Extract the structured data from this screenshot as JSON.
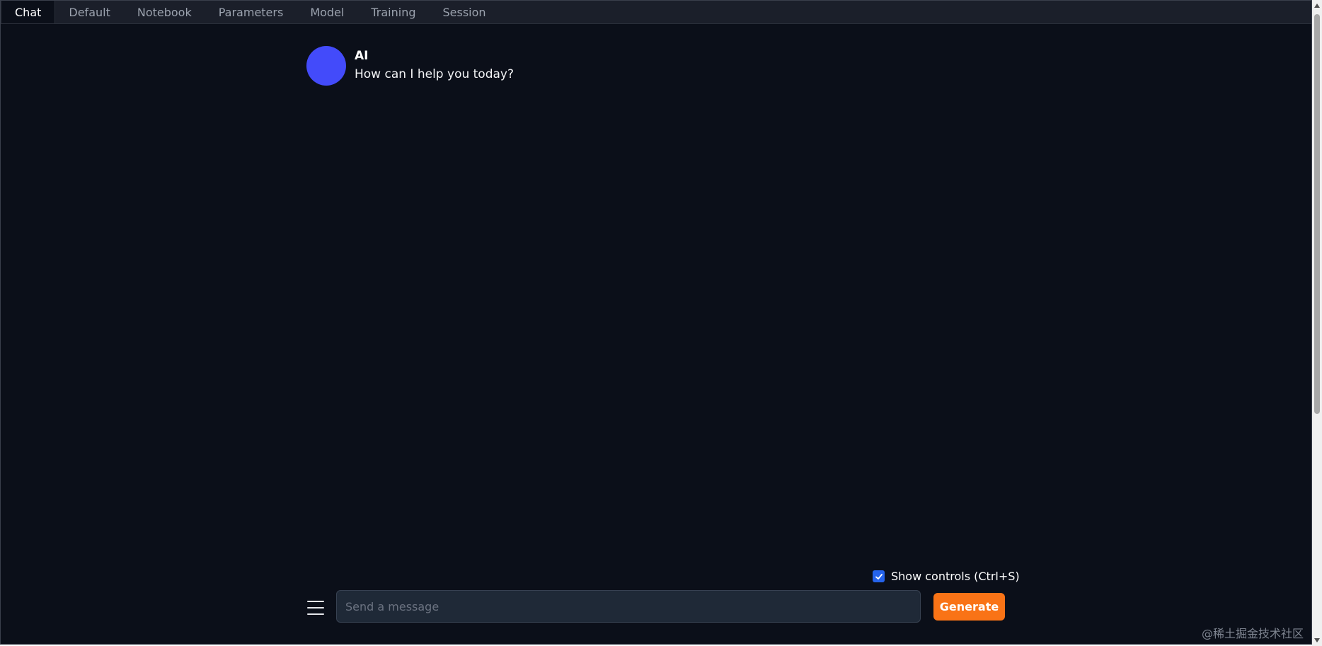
{
  "tabs": [
    {
      "label": "Chat",
      "active": true
    },
    {
      "label": "Default",
      "active": false
    },
    {
      "label": "Notebook",
      "active": false
    },
    {
      "label": "Parameters",
      "active": false
    },
    {
      "label": "Model",
      "active": false
    },
    {
      "label": "Training",
      "active": false
    },
    {
      "label": "Session",
      "active": false
    }
  ],
  "chat": {
    "messages": [
      {
        "author": "AI",
        "text": "How can I help you today?",
        "avatar_color": "#434bfa"
      }
    ]
  },
  "controls": {
    "show_controls_label": "Show controls (Ctrl+S)",
    "show_controls_checked": true,
    "input_placeholder": "Send a message",
    "input_value": "",
    "generate_label": "Generate",
    "menu_icon": "hamburger-menu-icon",
    "checkbox_icon": "checkmark-icon"
  },
  "watermark": "@稀土掘金技术社区",
  "colors": {
    "background": "#0b0f19",
    "tabbar": "#1b1f2a",
    "accent": "#f97316",
    "checkbox": "#2563eb",
    "input_bg": "#1f2937"
  }
}
